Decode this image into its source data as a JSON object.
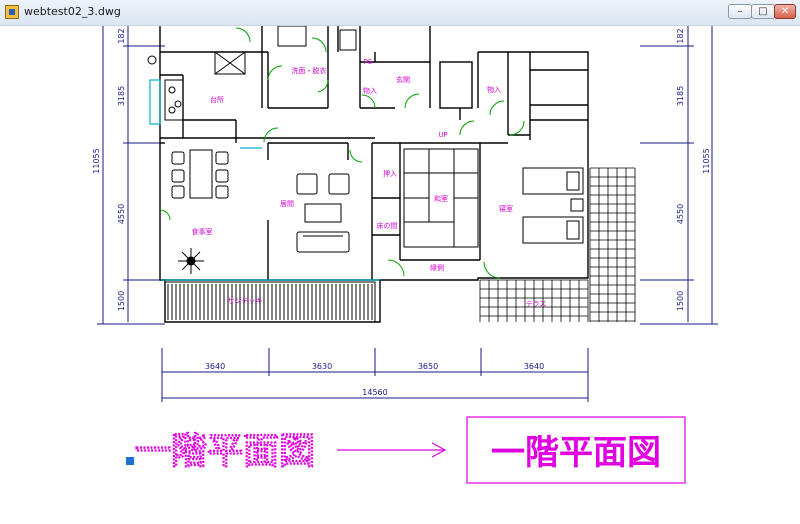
{
  "window": {
    "title": "webtest02_3.dwg"
  },
  "controls": {
    "minimize": "–",
    "maximize": "□",
    "close": "✕"
  },
  "dimensions": {
    "left": [
      "182",
      "3185",
      "4550",
      "1500"
    ],
    "left_total": "11055",
    "right": [
      "182",
      "3185",
      "4550",
      "1500"
    ],
    "right_total": "11055",
    "bottom": [
      "3640",
      "3630",
      "3650",
      "3640"
    ],
    "bottom_total": "14560"
  },
  "rooms": {
    "sentaku": "洗面・脱衣",
    "ps": "PS",
    "genkan": "玄関",
    "monoire1": "物入",
    "monoire2": "物入",
    "daidokoro": "台所",
    "oshiire": "押入",
    "yukanoma": "床の間",
    "washitsu": "和室",
    "shinshitsu": "寝室",
    "shokuji": "食事室",
    "ima": "居間",
    "engawa": "縁側",
    "deck": "サンデッキ",
    "terrace": "テラス",
    "up": "UP"
  },
  "annotation": {
    "outline_text": "一階平面図",
    "boxed_text": "一階平面図"
  },
  "colors": {
    "walls": "#000000",
    "room_labels": "#d400d4",
    "dimensions": "#1a1a8a",
    "doors": "#00a000",
    "title_text": "#e000e0"
  }
}
